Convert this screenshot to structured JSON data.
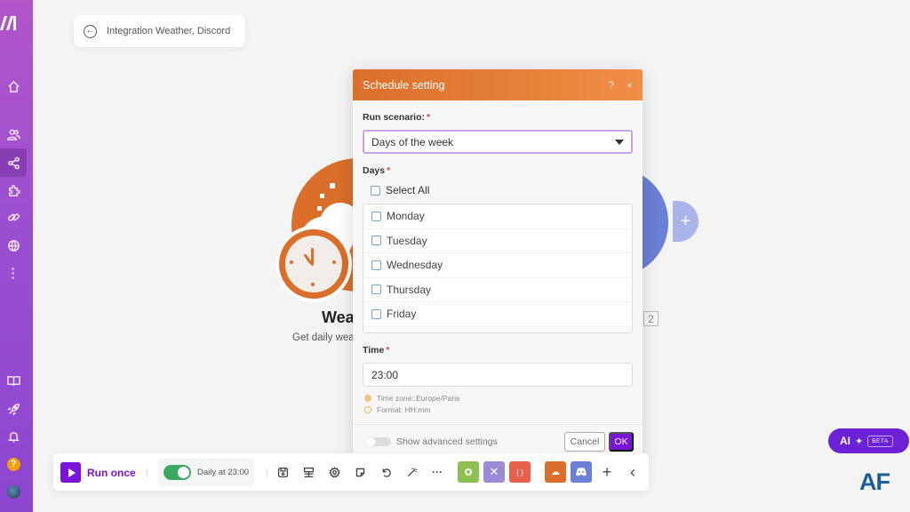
{
  "app": {
    "logo_text": "M"
  },
  "sidebar": {
    "items": [
      {
        "name": "home",
        "label": "Home"
      },
      {
        "name": "team",
        "label": "Team"
      },
      {
        "name": "scenarios",
        "label": "Scenarios",
        "active": true
      },
      {
        "name": "apps",
        "label": "Apps"
      },
      {
        "name": "connections",
        "label": "Connections"
      },
      {
        "name": "webhooks",
        "label": "Webhooks"
      },
      {
        "name": "more",
        "label": "More"
      }
    ],
    "bottom_items": [
      {
        "name": "docs",
        "label": "Documentation"
      },
      {
        "name": "whats-new",
        "label": "What's new"
      },
      {
        "name": "notifications",
        "label": "Notifications"
      },
      {
        "name": "help",
        "label": "?"
      },
      {
        "name": "profile",
        "label": "Profile"
      }
    ]
  },
  "breadcrumb": {
    "title": "Integration Weather, Discord"
  },
  "canvas": {
    "weather_module": {
      "title": "Wea",
      "subtitle": "Get daily wea"
    },
    "discord_module": {
      "count_badge": "2",
      "add_label": "+"
    }
  },
  "dialog": {
    "title": "Schedule setting",
    "help_label": "?",
    "close_label": "×",
    "run_scenario": {
      "label": "Run scenario:",
      "required_mark": "*",
      "value": "Days of the week"
    },
    "days": {
      "label": "Days",
      "required_mark": "*",
      "select_all_label": "Select All",
      "options": [
        "Monday",
        "Tuesday",
        "Wednesday",
        "Thursday",
        "Friday"
      ]
    },
    "time": {
      "label": "Time",
      "required_mark": "*",
      "value": "23:00",
      "timezone_hint": "Time zone: Europe/Paris",
      "format_hint": "Format: HH:mm"
    },
    "advanced_toggle_label": "Show advanced settings",
    "cancel_label": "Cancel",
    "ok_label": "OK"
  },
  "toolbar": {
    "run_once_label": "Run once",
    "schedule_label": "Daily at 23:00",
    "schedule_enabled": true,
    "more_label": "···",
    "add_label": "+",
    "collapse_label": "‹",
    "module_colors": {
      "tools": "#8cc152",
      "flow": "#9b8ad6",
      "json": "#e8604c",
      "weather": "#d96f2a",
      "discord": "#6a7fd6"
    }
  },
  "ai_badge": {
    "label": "AI",
    "spark": "✦",
    "beta_label": "BETA"
  },
  "watermark": {
    "text": "AF"
  }
}
